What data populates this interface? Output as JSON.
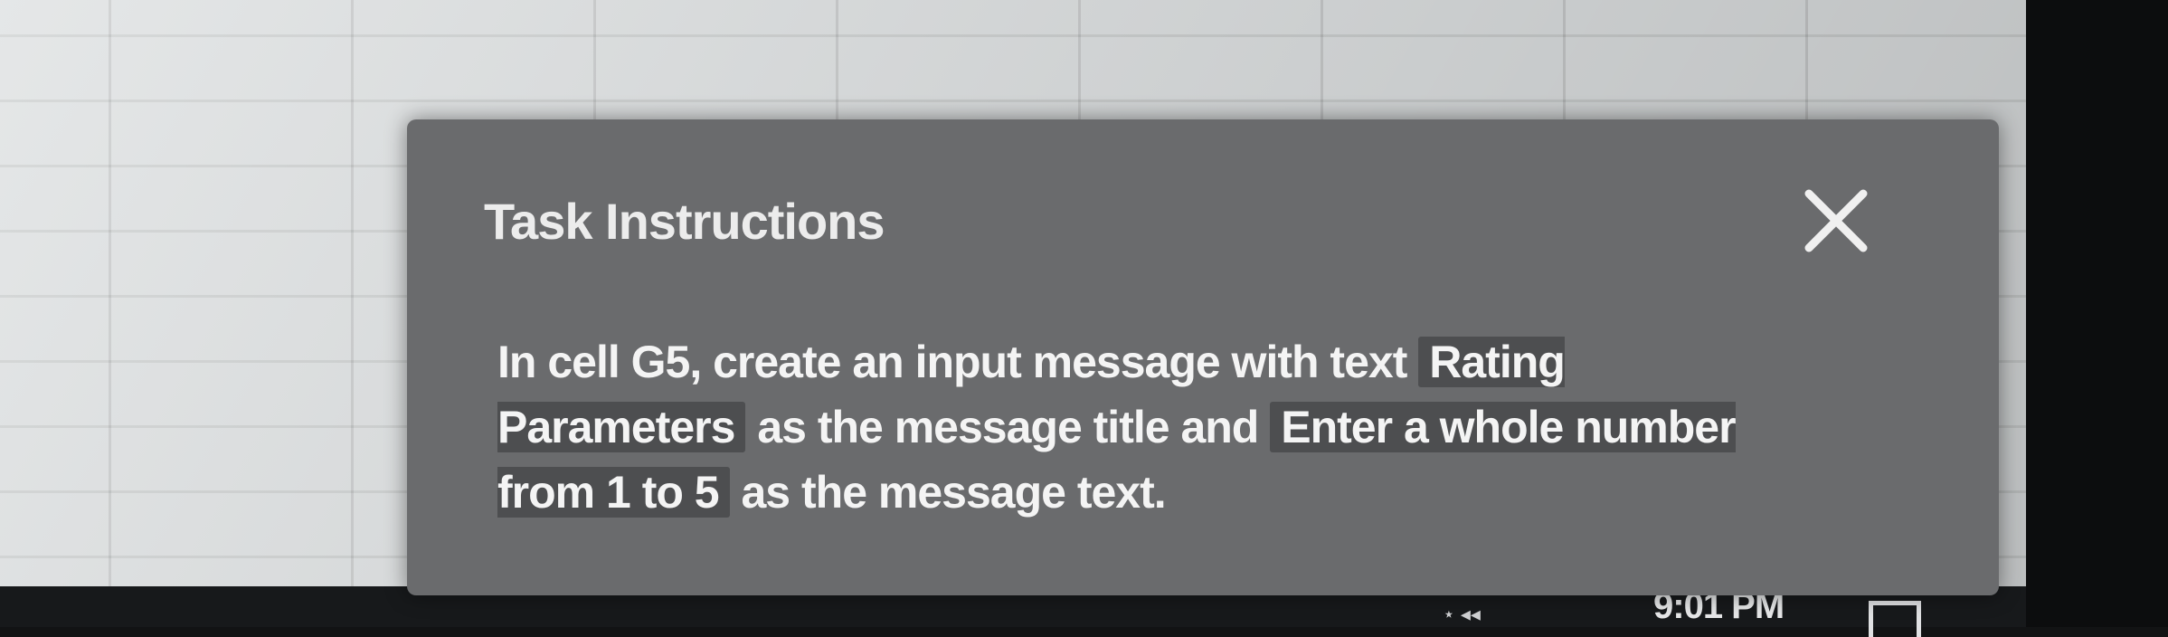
{
  "dialog": {
    "title": "Task Instructions",
    "close_icon": "close-icon",
    "instruction": {
      "part1": "In cell G5, create an input message with text",
      "highlight1": "Rating Parameters",
      "part2": "as the message title and",
      "highlight2": "Enter a whole number from 1 to 5",
      "part3": "as the message text."
    }
  },
  "taskbar": {
    "clock": "9:01 PM"
  }
}
